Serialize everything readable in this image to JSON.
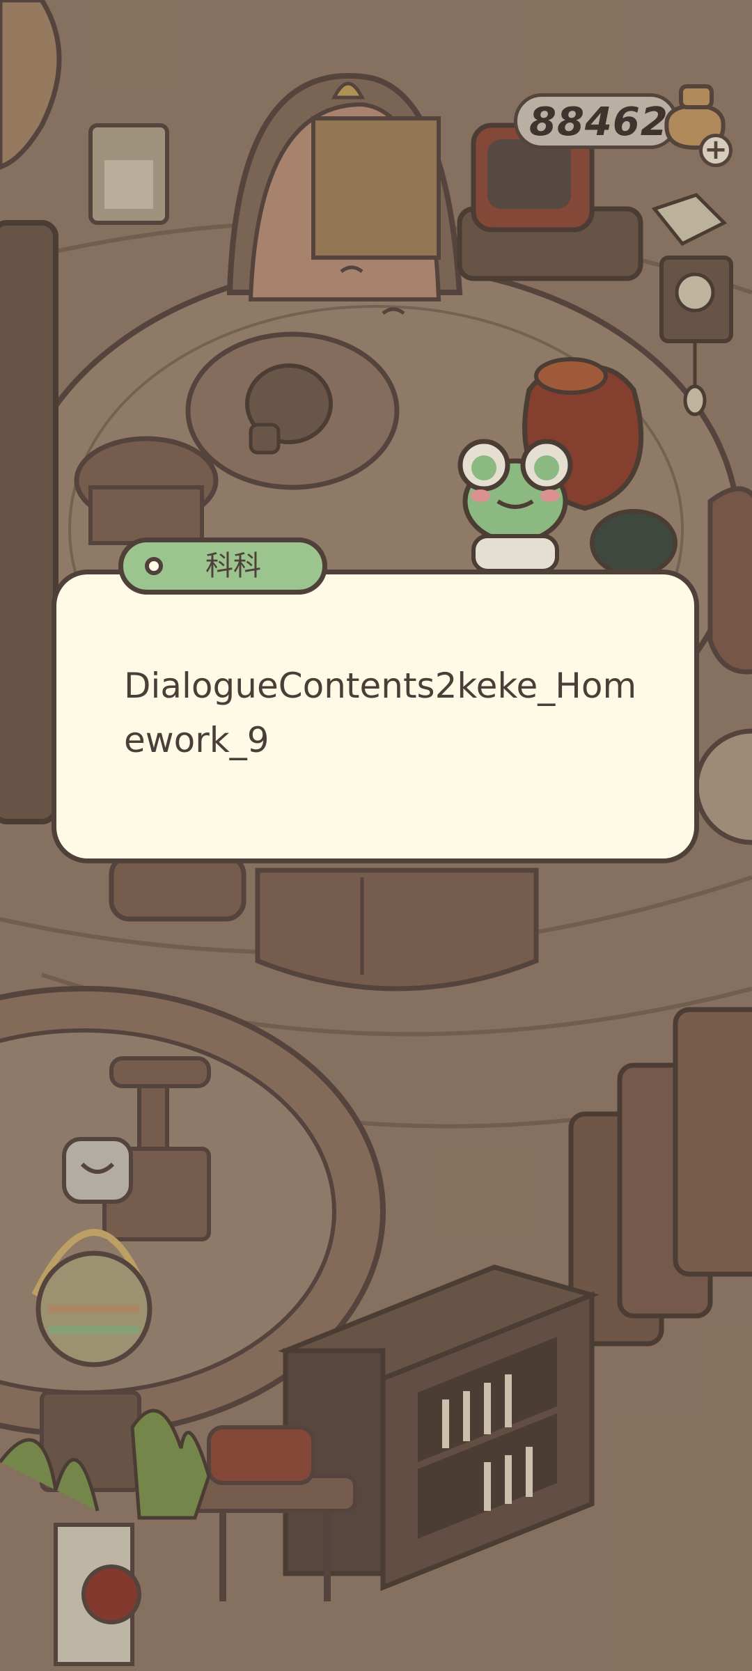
{
  "currency": {
    "amount": "88462",
    "plus_icon": "plus-icon",
    "coin_icon": "coin-pouch-icon"
  },
  "dialog": {
    "speaker": "科科",
    "text": "DialogueContents2keke_Homework_9"
  },
  "colors": {
    "background": "#8a7462",
    "dialog_bg": "#fefae6",
    "dialog_border": "#4f403a",
    "name_tag": "#9cc48e",
    "frog": "#93c48a"
  }
}
